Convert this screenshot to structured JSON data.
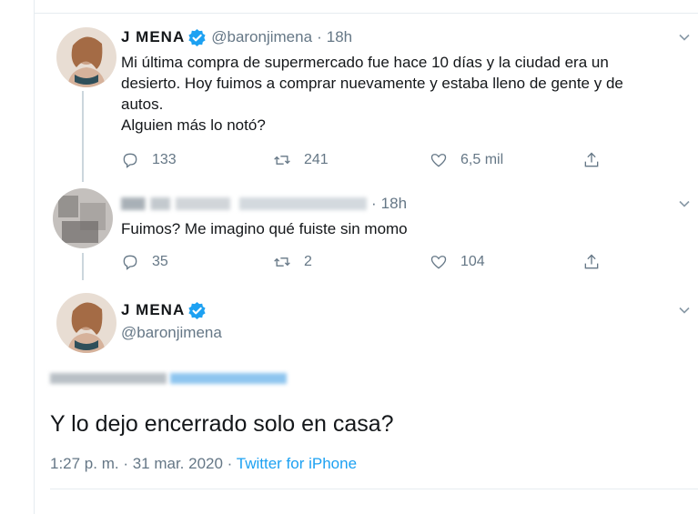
{
  "tweets": [
    {
      "display_name": "J MENA",
      "handle": "@baronjimena",
      "separator": "·",
      "time": "18h",
      "text_lines": [
        "Mi última compra de supermercado fue hace 10 días y la ciudad era un",
        "desierto. Hoy fuimos a comprar nuevamente y estaba lleno de gente y de",
        "autos.",
        "Alguien más lo notó?"
      ],
      "replies": "133",
      "retweets": "241",
      "likes": "6,5 mil",
      "icons": [
        "reply-icon",
        "retweet-icon",
        "like-icon",
        "share-icon",
        "chevron-down-icon",
        "verified-badge-icon"
      ]
    },
    {
      "display_name": "",
      "handle": "",
      "separator": "·",
      "time": "18h",
      "text": "Fuimos? Me imagino qué fuiste sin momo",
      "replies": "35",
      "retweets": "2",
      "likes": "104"
    }
  ],
  "main_tweet": {
    "display_name": "J MENA",
    "handle": "@baronjimena",
    "text": "Y lo dejo encerrado solo en casa?",
    "timestamp": "1:27 p. m. · 31 mar. 2020 · ",
    "source": "Twitter for iPhone"
  },
  "colors": {
    "accent": "#1da1f2",
    "muted": "#657786",
    "divider": "#e6ecf0"
  }
}
